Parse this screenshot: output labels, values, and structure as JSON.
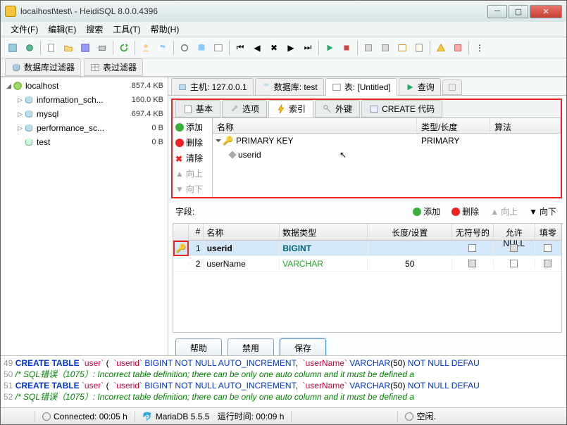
{
  "title": "localhost\\test\\ - HeidiSQL 8.0.0.4396",
  "menu": {
    "file": "文件(F)",
    "edit": "编辑(E)",
    "search": "搜索",
    "tools": "工具(T)",
    "help": "帮助(H)"
  },
  "filters": {
    "dbfilter": "数据库过滤器",
    "tablefilter": "表过滤器"
  },
  "tree": {
    "root": "localhost",
    "root_size": "857.4 KB",
    "db1": "information_sch...",
    "db1_size": "160.0 KB",
    "db2": "mysql",
    "db2_size": "697.4 KB",
    "db3": "performance_sc...",
    "db3_size": "0 B",
    "db4": "test",
    "db4_size": "0 B"
  },
  "tabs": {
    "host": "主机: 127.0.0.1",
    "database": "数据库: test",
    "table": "表: [Untitled]",
    "query": "查询"
  },
  "subtabs": {
    "basic": "基本",
    "options": "选项",
    "indexes": "索引",
    "fk": "外键",
    "create": "CREATE 代码"
  },
  "index_btns": {
    "add": "添加",
    "delete": "删除",
    "clear": "清除",
    "up": "向上",
    "down": "向下"
  },
  "index_head": {
    "name": "名称",
    "type": "类型/长度",
    "alg": "算法"
  },
  "indexes": {
    "pk": "PRIMARY KEY",
    "pk_type": "PRIMARY",
    "col1": "userid"
  },
  "fields": {
    "label": "字段:",
    "add": "添加",
    "del": "删除",
    "up": "向上",
    "down": "向下"
  },
  "col_head": {
    "num": "#",
    "name": "名称",
    "type": "数据类型",
    "len": "长度/设置",
    "uns": "无符号的",
    "null": "允许NULL",
    "fill": "填零"
  },
  "cols": {
    "r1": {
      "n": "1",
      "name": "userid",
      "type": "BIGINT",
      "len": ""
    },
    "r2": {
      "n": "2",
      "name": "userName",
      "type": "VARCHAR",
      "len": "50"
    }
  },
  "bottom": {
    "help": "帮助",
    "disable": "禁用",
    "save": "保存"
  },
  "sql": {
    "l49n": "49",
    "l49a": "CREATE TABLE",
    "l49b": "`user`",
    "l49c": "`userid`",
    "l49d": "BIGINT NOT NULL AUTO_INCREMENT",
    "l49e": "`userName`",
    "l49f": "VARCHAR",
    "l49g": "(50)",
    "l49h": "NOT NULL DEFAU",
    "l50n": "50",
    "l50": "/* SQL错误（1075）: Incorrect table definition; there can be only one auto column and it must be defined a",
    "l51n": "51",
    "l52n": "52"
  },
  "status": {
    "conn": "Connected: 00:05 h",
    "server": "MariaDB 5.5.5",
    "uptime": "运行时间: 00:09 h",
    "idle": "空闲."
  }
}
